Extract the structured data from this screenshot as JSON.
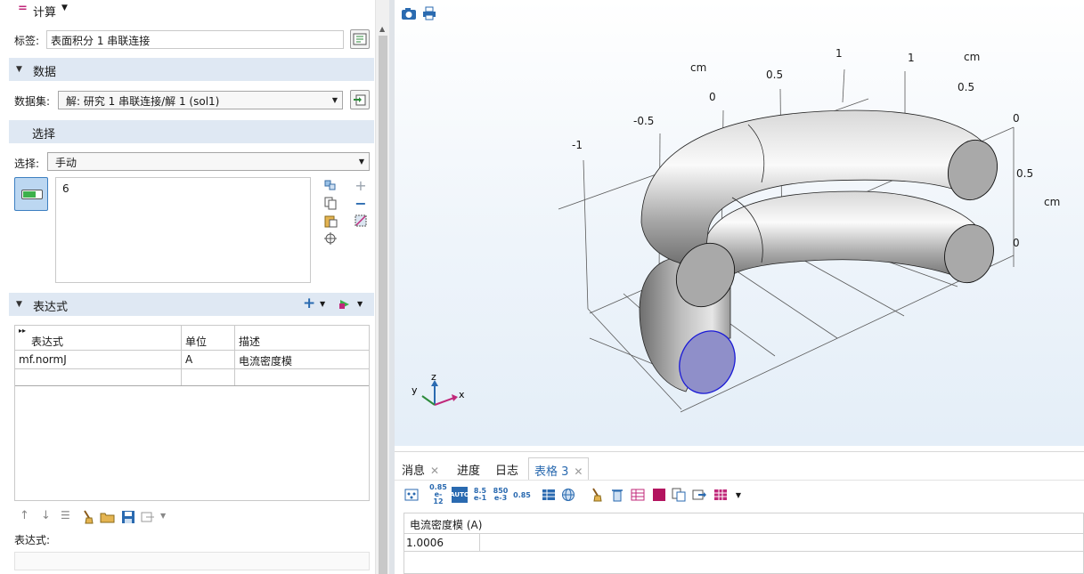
{
  "window": {
    "title": "计算"
  },
  "label_row": {
    "label": "标签:",
    "value": "表面积分 1 串联连接"
  },
  "data_section": {
    "title": "数据",
    "dataset_label": "数据集:",
    "dataset_value": "解: 研究 1 串联连接/解 1 (sol1)"
  },
  "selection_section": {
    "title": "选择",
    "selection_label": "选择:",
    "selection_value": "手动",
    "entities": [
      "6"
    ]
  },
  "expression_section": {
    "title": "表达式",
    "columns": [
      "表达式",
      "单位",
      "描述"
    ],
    "rows": [
      {
        "expression": "mf.normJ",
        "unit": "A",
        "description": "电流密度模"
      }
    ],
    "expression_field_label": "表达式:"
  },
  "graphics": {
    "axis_unit": "cm",
    "x_ticks": [
      "-1",
      "-0.5",
      "0",
      "0.5",
      "1"
    ],
    "y_ticks": [
      "1",
      "0.5",
      "0"
    ],
    "z_ticks": [
      "0.5",
      "0"
    ],
    "triad": {
      "x": "x",
      "y": "y",
      "z": "z"
    },
    "colors": {
      "selected_face": "#8f8fc9",
      "selected_edge": "#1b1bd6",
      "tube": "#a9a9a9"
    }
  },
  "bottom_tabs": [
    {
      "label": "消息",
      "closable": true
    },
    {
      "label": "进度",
      "closable": false
    },
    {
      "label": "日志",
      "closable": false
    },
    {
      "label": "表格 3",
      "closable": true,
      "active": true
    }
  ],
  "table_toolbar": {
    "formats": [
      "0.85 e-12",
      "AUTO",
      "8.5 e-1",
      "850 e-3",
      "0.85"
    ]
  },
  "results_table": {
    "header": "电流密度模 (A)",
    "value": "1.0006"
  }
}
